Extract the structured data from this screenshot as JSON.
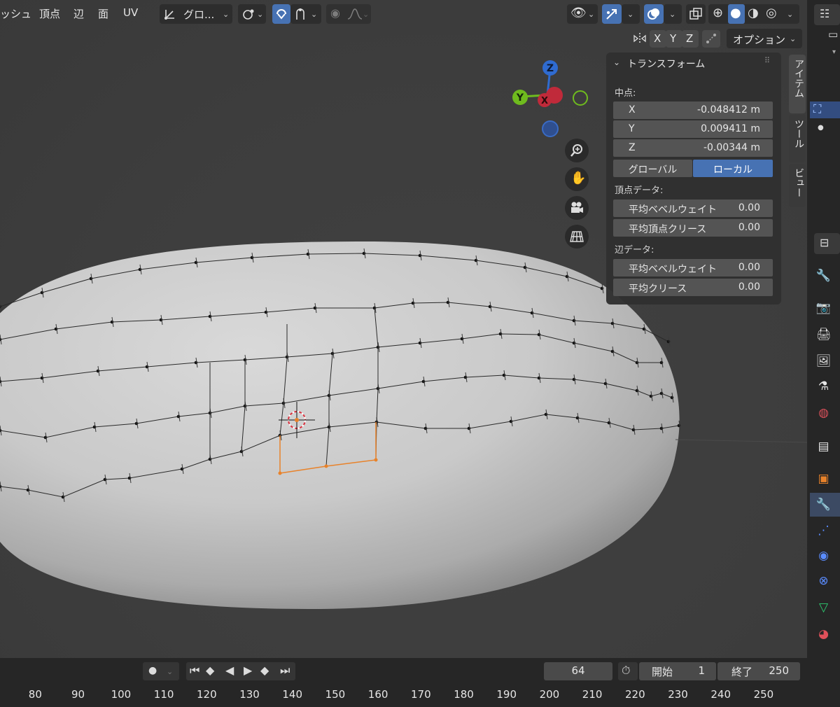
{
  "header": {
    "menus": [
      "ッシュ",
      "頂点",
      "辺",
      "面",
      "UV"
    ],
    "orientation_label": "グロ...",
    "axes": [
      "X",
      "Y",
      "Z"
    ],
    "options_label": "オプション"
  },
  "gizmo": {
    "z": "Z",
    "y": "Y",
    "x": "X"
  },
  "nav_icons": [
    "zoom-icon",
    "hand-icon",
    "camera-icon",
    "grid-icon"
  ],
  "npanel": {
    "title": "トランスフォーム",
    "median_label": "中点:",
    "median": [
      {
        "axis": "X",
        "value": "-0.048412 m"
      },
      {
        "axis": "Y",
        "value": "0.009411 m"
      },
      {
        "axis": "Z",
        "value": "-0.00344 m"
      }
    ],
    "space_global": "グローバル",
    "space_local": "ローカル",
    "vertex_data_label": "頂点データ:",
    "vertex_fields": [
      {
        "label": "平均ベベルウェイト",
        "value": "0.00"
      },
      {
        "label": "平均頂点クリース",
        "value": "0.00"
      }
    ],
    "edge_data_label": "辺データ:",
    "edge_fields": [
      {
        "label": "平均ベベルウェイト",
        "value": "0.00"
      },
      {
        "label": "平均クリース",
        "value": "0.00"
      }
    ]
  },
  "side_tabs": [
    "アイテム",
    "ツール",
    "ビュー"
  ],
  "timeline": {
    "current_frame": "64",
    "start_label": "開始",
    "start_value": "1",
    "end_label": "終了",
    "end_value": "250",
    "ticks": [
      "80",
      "90",
      "100",
      "110",
      "120",
      "130",
      "140",
      "150",
      "160",
      "170",
      "180",
      "190",
      "200",
      "210",
      "220",
      "230",
      "240",
      "250"
    ]
  },
  "colors": {
    "accent": "#4772b3",
    "selection": "#e8822a",
    "gizmo_x": "#d9323f",
    "gizmo_y": "#6fbb1e",
    "gizmo_z": "#2f6bd0"
  }
}
